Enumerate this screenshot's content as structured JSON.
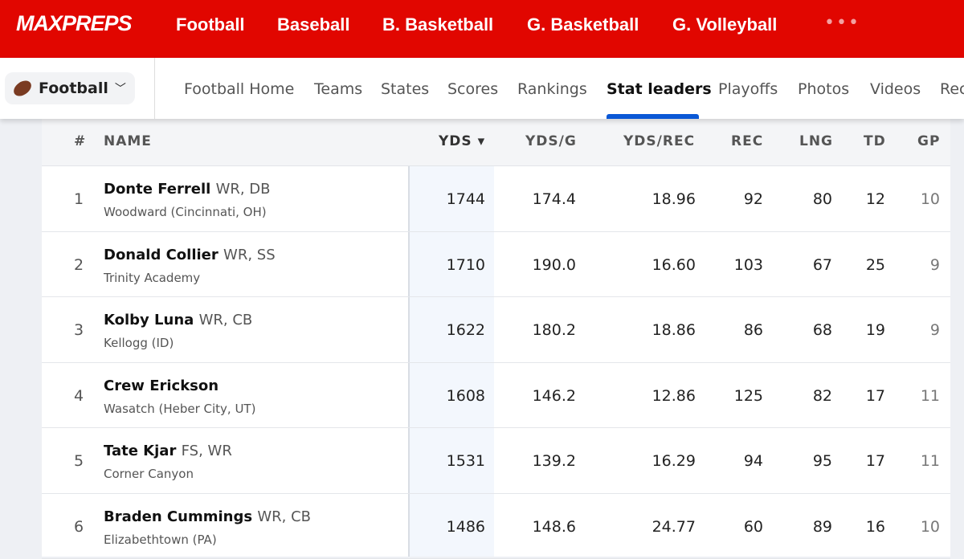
{
  "brand": "MAXPREPS",
  "top_nav": [
    "Football",
    "Baseball",
    "B. Basketball",
    "G. Basketball",
    "G. Volleyball"
  ],
  "more": "•••",
  "sport_select": "Football",
  "sub_nav": [
    "Football Home",
    "Teams",
    "States",
    "Scores",
    "Rankings",
    "Stat leaders",
    "Playoffs",
    "Photos",
    "Videos",
    "Rec"
  ],
  "columns": [
    "#",
    "NAME",
    "YDS ▾",
    "YDS/G",
    "YDS/REC",
    "REC",
    "LNG",
    "TD",
    "GP"
  ],
  "rows": [
    {
      "rank": "1",
      "name": "Donte Ferrell",
      "pos": "WR, DB",
      "school": "Woodward (Cincinnati, OH)",
      "yds": "1744",
      "ydsg": "174.4",
      "ydsrec": "18.96",
      "rec": "92",
      "lng": "80",
      "td": "12",
      "gp": "10"
    },
    {
      "rank": "2",
      "name": "Donald Collier",
      "pos": "WR, SS",
      "school": "Trinity Academy",
      "yds": "1710",
      "ydsg": "190.0",
      "ydsrec": "16.60",
      "rec": "103",
      "lng": "67",
      "td": "25",
      "gp": "9"
    },
    {
      "rank": "3",
      "name": "Kolby Luna",
      "pos": "WR, CB",
      "school": "Kellogg (ID)",
      "yds": "1622",
      "ydsg": "180.2",
      "ydsrec": "18.86",
      "rec": "86",
      "lng": "68",
      "td": "19",
      "gp": "9"
    },
    {
      "rank": "4",
      "name": "Crew Erickson",
      "pos": "",
      "school": "Wasatch (Heber City, UT)",
      "yds": "1608",
      "ydsg": "146.2",
      "ydsrec": "12.86",
      "rec": "125",
      "lng": "82",
      "td": "17",
      "gp": "11"
    },
    {
      "rank": "5",
      "name": "Tate Kjar",
      "pos": "FS, WR",
      "school": "Corner Canyon",
      "yds": "1531",
      "ydsg": "139.2",
      "ydsrec": "16.29",
      "rec": "94",
      "lng": "95",
      "td": "17",
      "gp": "11"
    },
    {
      "rank": "6",
      "name": "Braden Cummings",
      "pos": "WR, CB",
      "school": "Elizabethtown (PA)",
      "yds": "1486",
      "ydsg": "148.6",
      "ydsrec": "24.77",
      "rec": "60",
      "lng": "89",
      "td": "16",
      "gp": "10"
    }
  ],
  "colors": {
    "brand_red": "#e10600",
    "active_underline": "#0a58d6"
  }
}
